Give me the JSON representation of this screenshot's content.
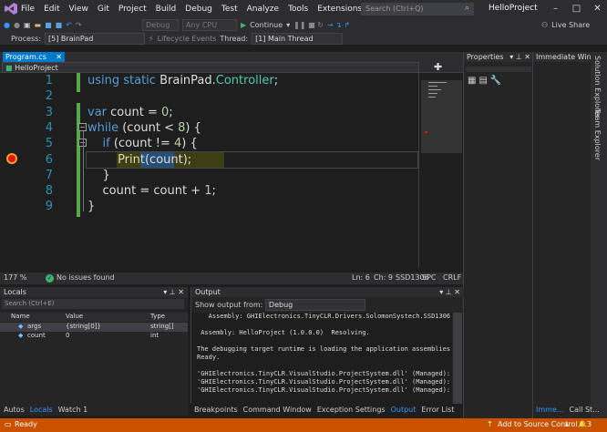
{
  "menu": [
    "File",
    "Edit",
    "View",
    "Git",
    "Project",
    "Build",
    "Debug",
    "Test",
    "Analyze",
    "Tools",
    "Extensions",
    "Window",
    "Help"
  ],
  "search": {
    "placeholder": "Search (Ctrl+Q)"
  },
  "project_name": "HelloProject",
  "toolbar": {
    "config": "Debug",
    "platform": "Any CPU",
    "continue_label": "Continue",
    "live_share": "Live Share"
  },
  "debug_bar": {
    "process_label": "Process:",
    "process_value": "[5] BrainPad",
    "lifecycle": "Lifecycle Events",
    "thread_label": "Thread:",
    "thread_value": "[1] Main Thread"
  },
  "editor": {
    "tab": "Program.cs",
    "nav": "HelloProject",
    "lines": [
      {
        "n": "1",
        "html": "<span class=\"kw\">using static</span> BrainPad.<span class=\"ty\">Controller</span>;",
        "indent": 0
      },
      {
        "n": "2",
        "html": "",
        "indent": 0
      },
      {
        "n": "3",
        "html": "<span class=\"kw\">var</span> count = <span class=\"nu\">0</span>;",
        "indent": 0
      },
      {
        "n": "4",
        "html": "<span class=\"kw\">while</span> (count &lt; <span class=\"nu\">8</span>) {",
        "indent": 0
      },
      {
        "n": "5",
        "html": "    <span class=\"kw\">if</span> (count != <span class=\"nu\">4</span>) {",
        "indent": 0
      },
      {
        "n": "6",
        "html": "        <span class=\"fn\">Print</span>(count);",
        "indent": 0
      },
      {
        "n": "7",
        "html": "    }",
        "indent": 0
      },
      {
        "n": "8",
        "html": "    count = count + <span class=\"nu\">1</span>;",
        "indent": 0
      },
      {
        "n": "9",
        "html": "}",
        "indent": 0
      }
    ],
    "zoom": "177 %",
    "issues": "No issues found",
    "ln": "Ln: 6",
    "ch": "Ch: 9",
    "col": "Col: 9",
    "ssd": "SSD1306",
    "spc": "SPC",
    "crlf": "CRLF"
  },
  "properties": {
    "title": "Properties"
  },
  "immediate": {
    "title": "Immediate Wind..."
  },
  "sidetabs": [
    "Solution Explorer",
    "Team Explorer"
  ],
  "locals": {
    "title": "Locals",
    "search": "Search (Ctrl+E)",
    "cols": [
      "Name",
      "Value",
      "Type"
    ],
    "rows": [
      [
        "args",
        "{string[0]}",
        "string[]"
      ],
      [
        "count",
        "0",
        "int"
      ]
    ]
  },
  "bottom_left_tabs": [
    "Autos",
    "Locals",
    "Watch 1"
  ],
  "output": {
    "title": "Output",
    "from_label": "Show output from:",
    "from_value": "Debug",
    "lines": [
      "   Assembly: GHIElectronics.TinyCLR.Drivers.SolomonSystech.SSD1306 (2.1.0",
      "",
      " Assembly: HelloProject (1.0.0.0)  Resolving.",
      "",
      "The debugging target runtime is loading the application assemblies and st",
      "Ready.",
      "",
      "'GHIElectronics.TinyCLR.VisualStudio.ProjectSystem.dll' (Managed): Loaded",
      "'GHIElectronics.TinyCLR.VisualStudio.ProjectSystem.dll' (Managed): Loaded",
      "'GHIElectronics.TinyCLR.VisualStudio.ProjectSystem.dll' (Managed): Loaded"
    ]
  },
  "bottom_mid_tabs": [
    "Breakpoints",
    "Command Window",
    "Exception Settings",
    "Output",
    "Error List"
  ],
  "bottom_right_tabs": [
    "Imme...",
    "Call St..."
  ],
  "status": {
    "ready": "Ready",
    "source_control": "Add to Source Control",
    "notif": "3"
  }
}
